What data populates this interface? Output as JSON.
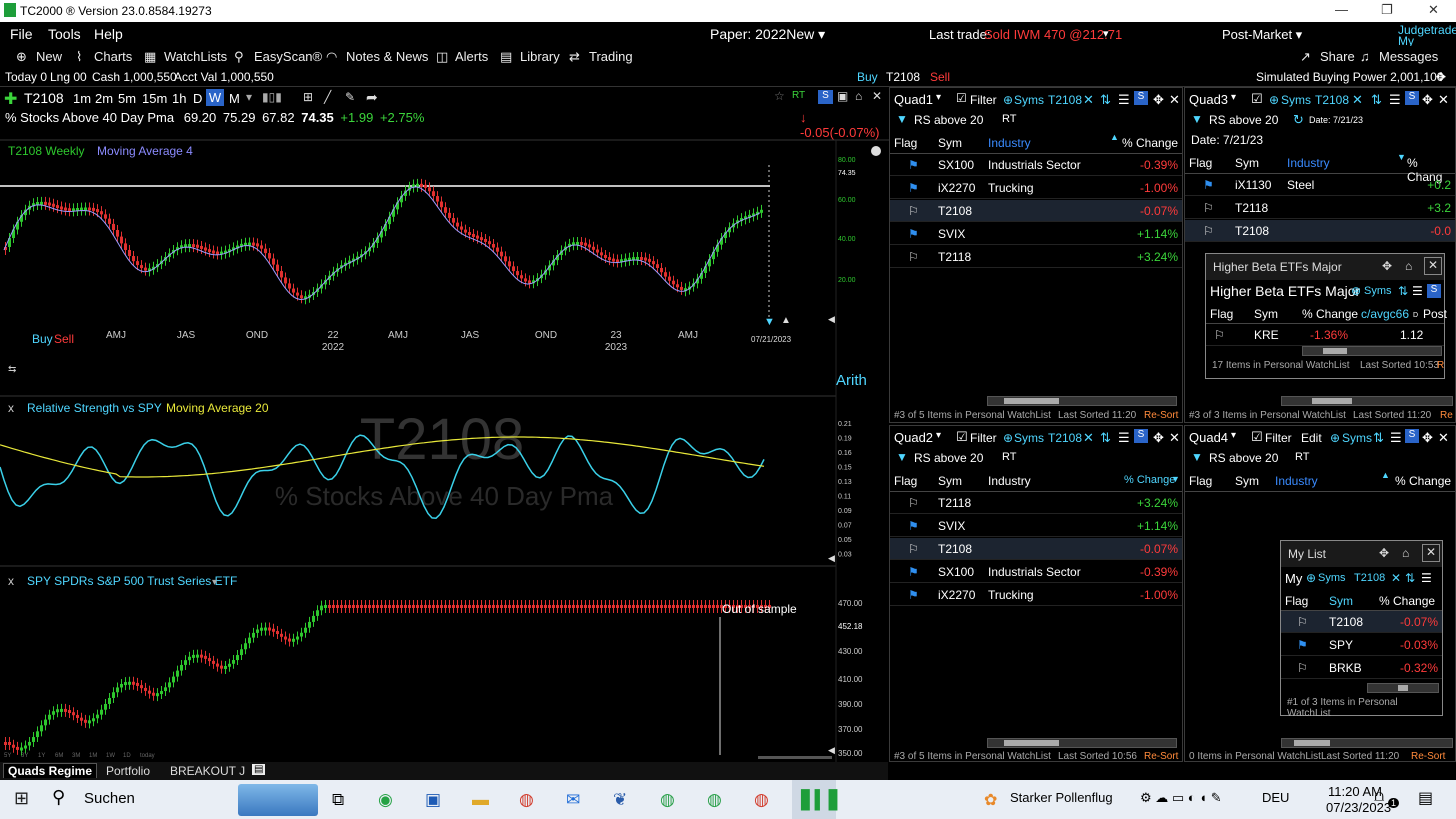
{
  "window": {
    "title": "TC2000 ® Version 23.0.8584.19273"
  },
  "menu": [
    "File",
    "Tools",
    "Help"
  ],
  "paper": "Paper: 2022New ▾",
  "last_trade_label": "Last trade:",
  "last_trade_value": "Sold IWM 470 @212.71",
  "post_market": "Post-Market ▾",
  "judgetrade": "Judgetrade",
  "my_services": "My Services",
  "toolbar": [
    "New",
    "Charts",
    "WatchLists",
    "EasyScan®",
    "Notes & News",
    "Alerts",
    "Library",
    "Trading"
  ],
  "share": "Share",
  "messages": "Messages",
  "status": {
    "today": "Today 0",
    "lng": "Lng 0",
    "zero": "0",
    "cash": "Cash 1,000,550",
    "acct": "Acct Val 1,000,550",
    "buy": "Buy",
    "sym": "T2108",
    "sell": "Sell",
    "buying_power": "Simulated Buying Power 2,001,100"
  },
  "chart": {
    "symbol": "T2108",
    "intervals": [
      "1m",
      "2m",
      "5m",
      "15m",
      "1h",
      "D",
      "W",
      "M"
    ],
    "name": "% Stocks Above 40 Day Pma",
    "open": "69.20",
    "high": "75.29",
    "low": "67.82",
    "last": "74.35",
    "chg": "+1.99",
    "pct": "+2.75%",
    "ext": "-0.05(-0.07%)",
    "p1_label": "T2108 Weekly",
    "p1_ma": "Moving Average 4",
    "arith": "Arith",
    "p1_axis": [
      "80.00",
      "74.35",
      "60.00",
      "40.00",
      "20.00"
    ],
    "x_labels": [
      "AMJ",
      "JAS",
      "OND",
      "22",
      "AMJ",
      "JAS",
      "OND",
      "23",
      "AMJ"
    ],
    "years": [
      "2022",
      "2023"
    ],
    "date_tag": "07/21/2023",
    "buy": "Buy",
    "sell": "Sell",
    "p2_label": "Relative Strength vs SPY",
    "p2_ma": "Moving Average 20",
    "watermark1": "T2108",
    "watermark2": "% Stocks Above 40 Day Pma",
    "p2_axis": [
      "0.21",
      "0.19",
      "0.16",
      "0.15",
      "0.13",
      "0.11",
      "0.09",
      "0.07",
      "0.05",
      "0.03"
    ],
    "p3_label": "SPY SPDRs S&P 500 Trust Series ETF",
    "oos": "Out of sample",
    "p3_axis": [
      "470.00",
      "452.18",
      "430.00",
      "410.00",
      "390.00",
      "370.00",
      "350.00",
      "330.00"
    ],
    "ranges": [
      "5Y",
      "3Y",
      "1Y",
      "6M",
      "3M",
      "1M",
      "1W",
      "1D",
      "today"
    ]
  },
  "quad1": {
    "title": "Quad1",
    "filter": "Filter",
    "syms": "Syms",
    "sym": "T2108",
    "rs": "RS above 20",
    "rt": "RT",
    "cols": [
      "Flag",
      "Sym",
      "Industry",
      "% Change"
    ],
    "rows": [
      {
        "flag": "b",
        "sym": "SX100",
        "ind": "Industrials Sector",
        "chg": "-0.39%"
      },
      {
        "flag": "b",
        "sym": "iX2270",
        "ind": "Trucking",
        "chg": "-1.00%"
      },
      {
        "flag": "w",
        "sym": "T2108",
        "ind": "",
        "chg": "-0.07%"
      },
      {
        "flag": "b",
        "sym": "SVIX",
        "ind": "",
        "chg": "+1.14%"
      },
      {
        "flag": "w",
        "sym": "T2118",
        "ind": "",
        "chg": "+3.24%"
      }
    ],
    "footer": "#3 of 5 Items in Personal WatchList",
    "sorted": "Last Sorted 11:20",
    "resort": "Re-Sort"
  },
  "quad2": {
    "title": "Quad2",
    "filter": "Filter",
    "syms": "Syms",
    "sym": "T2108",
    "rs": "RS above 20",
    "rt": "RT",
    "cols": [
      "Flag",
      "Sym",
      "Industry",
      "% Change"
    ],
    "rows": [
      {
        "flag": "w",
        "sym": "T2118",
        "ind": "",
        "chg": "+3.24%"
      },
      {
        "flag": "b",
        "sym": "SVIX",
        "ind": "",
        "chg": "+1.14%"
      },
      {
        "flag": "w",
        "sym": "T2108",
        "ind": "",
        "chg": "-0.07%"
      },
      {
        "flag": "b",
        "sym": "SX100",
        "ind": "Industrials Sector",
        "chg": "-0.39%"
      },
      {
        "flag": "b",
        "sym": "iX2270",
        "ind": "Trucking",
        "chg": "-1.00%"
      }
    ],
    "footer": "#3 of 5 Items in Personal WatchList",
    "sorted": "Last Sorted 10:56",
    "resort": "Re-Sort"
  },
  "quad3": {
    "title": "Quad3",
    "syms": "Syms",
    "sym": "T2108",
    "rs": "RS above 20",
    "date1": "Date: 7/21/23",
    "date2": "Date: 7/21/23",
    "cols": [
      "Flag",
      "Sym",
      "Industry",
      "% Chang"
    ],
    "rows": [
      {
        "flag": "b",
        "sym": "iX1130",
        "ind": "Steel",
        "chg": "+0.2"
      },
      {
        "flag": "w",
        "sym": "T2118",
        "ind": "",
        "chg": "+3.2"
      },
      {
        "flag": "w",
        "sym": "T2108",
        "ind": "",
        "chg": "-0.0"
      }
    ],
    "footer": "#3 of 3 Items in Personal WatchList",
    "sorted": "Last Sorted 11:20",
    "resort": "Re"
  },
  "quad4": {
    "title": "Quad4",
    "filter": "Filter",
    "edit": "Edit",
    "syms": "Syms",
    "rs": "RS above 20",
    "rt": "RT",
    "cols": [
      "Flag",
      "Sym",
      "Industry",
      "% Change"
    ],
    "footer": "0 Items in Personal WatchList",
    "sorted": "Last Sorted 11:20",
    "resort": "Re-Sort"
  },
  "hb": {
    "title": "Higher Beta ETFs Major",
    "title2": "Higher Beta ETFs Major",
    "syms": "Syms",
    "cols": [
      "Flag",
      "Sym",
      "% Change",
      "c/avgc66",
      "D",
      "Post"
    ],
    "row": {
      "sym": "KRE",
      "chg": "-1.36%",
      "val": "1.12"
    },
    "footer": "17 Items in Personal WatchList",
    "sorted": "Last Sorted 10:53",
    "resort": "R"
  },
  "ml": {
    "title": "My List",
    "short": "My",
    "syms": "Syms",
    "sym": "T2108",
    "cols": [
      "Flag",
      "Sym",
      "% Change"
    ],
    "rows": [
      {
        "flag": "w",
        "sym": "T2108",
        "chg": "-0.07%"
      },
      {
        "flag": "b",
        "sym": "SPY",
        "chg": "-0.03%"
      },
      {
        "flag": "w",
        "sym": "BRKB",
        "chg": "-0.32%"
      }
    ],
    "footer": "#1 of 3 Items in Personal WatchList"
  },
  "tabs": [
    "Quads Regime",
    "Portfolio",
    "BREAKOUT J"
  ],
  "taskbar": {
    "search": "Suchen",
    "weather": "Starker Pollenflug",
    "lang": "DEU",
    "time": "11:20 AM",
    "date": "07/23/2023",
    "notif": "1"
  }
}
